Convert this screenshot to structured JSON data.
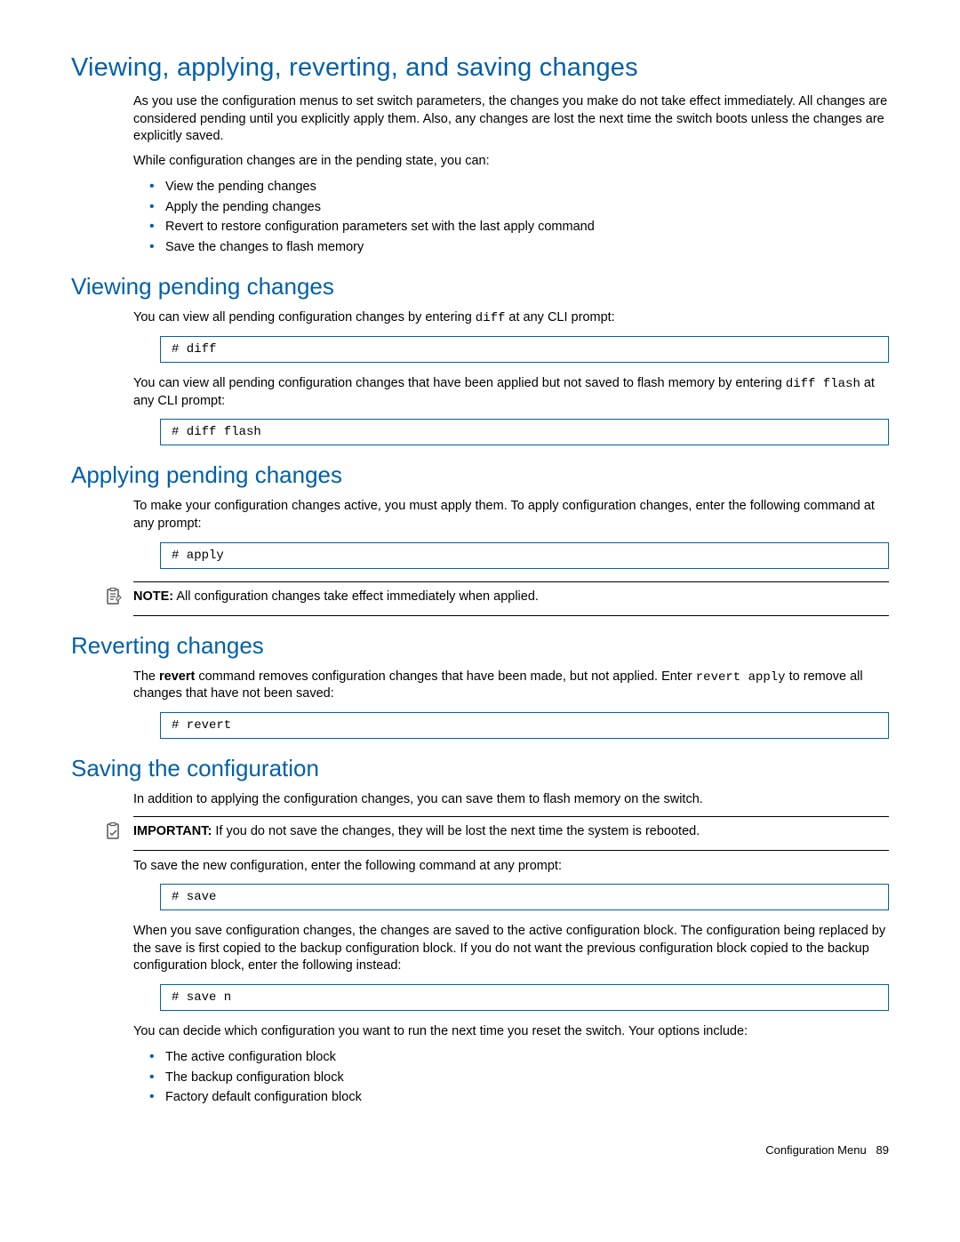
{
  "h1": "Viewing, applying, reverting, and saving changes",
  "intro": {
    "p1": "As you use the configuration menus to set switch parameters, the changes you make do not take effect immediately. All changes are considered pending until you explicitly apply them. Also, any changes are lost the next time the switch boots unless the changes are explicitly saved.",
    "p2": "While configuration changes are in the pending state, you can:",
    "bullets": [
      "View the pending changes",
      "Apply the pending changes",
      "Revert to restore configuration parameters set with the last apply command",
      "Save the changes to flash memory"
    ]
  },
  "viewing": {
    "heading": "Viewing pending changes",
    "p1_a": "You can view all pending configuration changes by entering ",
    "p1_code": "diff",
    "p1_b": " at any CLI prompt:",
    "code1": "# diff",
    "p2_a": "You can view all pending configuration changes that have been applied but not saved to flash memory by entering ",
    "p2_code": "diff flash",
    "p2_b": " at any CLI prompt:",
    "code2": "# diff flash"
  },
  "applying": {
    "heading": "Applying pending changes",
    "p1": "To make your configuration changes active, you must apply them. To apply configuration changes, enter the following command at any prompt:",
    "code1": "# apply",
    "note_label": "NOTE:",
    "note_text": "  All configuration changes take effect immediately when applied."
  },
  "reverting": {
    "heading": "Reverting changes",
    "p1_a": "The ",
    "p1_bold": "revert",
    "p1_b": " command removes configuration changes that have been made, but not applied. Enter ",
    "p1_code": "revert apply",
    "p1_c": " to remove all changes that have not been saved:",
    "code1": "# revert"
  },
  "saving": {
    "heading": "Saving the configuration",
    "p1": "In addition to applying the configuration changes, you can save them to flash memory on the switch.",
    "important_label": "IMPORTANT:",
    "important_text": "  If you do not save the changes, they will be lost the next time the system is rebooted.",
    "p2": "To save the new configuration, enter the following command at any prompt:",
    "code1": "# save",
    "p3": "When you save configuration changes, the changes are saved to the active configuration block. The configuration being replaced by the save is first copied to the backup configuration block. If you do not want the previous configuration block copied to the backup configuration block, enter the following instead:",
    "code2": "# save n",
    "p4": "You can decide which configuration you want to run the next time you reset the switch. Your options include:",
    "bullets": [
      "The active configuration block",
      "The backup configuration block",
      "Factory default configuration block"
    ]
  },
  "footer": {
    "section": "Configuration Menu",
    "page": "89"
  }
}
